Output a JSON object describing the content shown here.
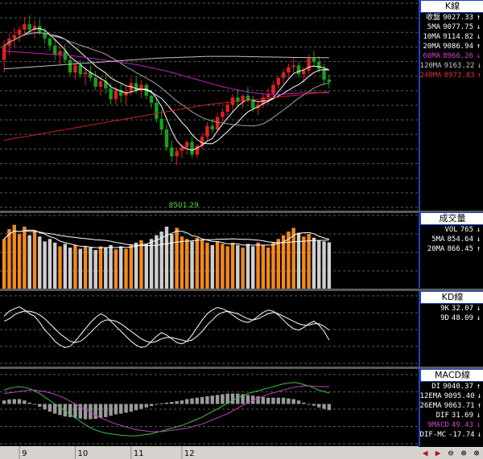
{
  "colors": {
    "up": "#e02020",
    "down": "#18a018",
    "vol_up": "#f28a1e",
    "vol_down": "#cfcfcf",
    "ma5": "#ffffff",
    "ma10": "#ffffff",
    "ma20": "#a0a0a0",
    "ma60": "#c020c0",
    "ma120": "#c0c0c0",
    "ma240": "#d02020",
    "panel_border": "#1a44c8"
  },
  "x_axis": {
    "ticks": [
      "9",
      "10",
      "11",
      "12"
    ]
  },
  "k_panel": {
    "title": "K線",
    "rows": [
      {
        "label": "收盤",
        "value": "9027.33",
        "arrow": "↑",
        "color": "#ffffff"
      },
      {
        "label": "5MA",
        "value": "9077.75",
        "arrow": "↓",
        "color": "#ffffff"
      },
      {
        "label": "10MA",
        "value": "9114.82",
        "arrow": "↓",
        "color": "#ffffff"
      },
      {
        "label": "20MA",
        "value": "9086.94",
        "arrow": "↑",
        "color": "#ffffff"
      },
      {
        "label": "60MA",
        "value": "8966.26",
        "arrow": "↓",
        "color": "#d040d0"
      },
      {
        "label": "120MA",
        "value": "9163.22",
        "arrow": "↓",
        "color": "#c8c8c8"
      },
      {
        "label": "240MA",
        "value": "8973.83",
        "arrow": "↑",
        "color": "#e03030"
      }
    ],
    "low_label": "8501.29"
  },
  "vol_panel": {
    "title": "成交量",
    "rows": [
      {
        "label": "VOL",
        "value": "765",
        "arrow": "↓",
        "color": "#ffffff"
      },
      {
        "label": "5MA",
        "value": "854.64",
        "arrow": "↓",
        "color": "#ffffff"
      },
      {
        "label": "20MA",
        "value": "866.45",
        "arrow": "↑",
        "color": "#ffffff"
      }
    ]
  },
  "kd_panel": {
    "title": "KD線",
    "rows": [
      {
        "label": "9K",
        "value": "32.07",
        "arrow": "↓",
        "color": "#ffffff"
      },
      {
        "label": "9D",
        "value": "48.09",
        "arrow": "↓",
        "color": "#ffffff"
      }
    ]
  },
  "macd_panel": {
    "title": "MACD線",
    "rows": [
      {
        "label": "DI",
        "value": "9040.37",
        "arrow": "↑",
        "color": "#ffffff"
      },
      {
        "label": "12EMA",
        "value": "9095.40",
        "arrow": "↓",
        "color": "#ffffff"
      },
      {
        "label": "26EMA",
        "value": "9063.71",
        "arrow": "↑",
        "color": "#ffffff"
      },
      {
        "label": "DIF",
        "value": "31.69",
        "arrow": "↓",
        "color": "#ffffff"
      },
      {
        "label": "9MACD",
        "value": "49.43",
        "arrow": "↓",
        "color": "#d040d0"
      },
      {
        "label": "DIF-MC",
        "value": "-17.74",
        "arrow": "↓",
        "color": "#ffffff"
      }
    ]
  },
  "chart_data": {
    "type": "candlestick",
    "ylim": [
      8450,
      9450
    ],
    "candles": [
      [
        9150,
        9260,
        9080,
        9230
      ],
      [
        9230,
        9300,
        9180,
        9270
      ],
      [
        9270,
        9330,
        9220,
        9290
      ],
      [
        9290,
        9340,
        9250,
        9320
      ],
      [
        9320,
        9390,
        9280,
        9350
      ],
      [
        9350,
        9400,
        9300,
        9320
      ],
      [
        9320,
        9370,
        9270,
        9340
      ],
      [
        9340,
        9380,
        9290,
        9300
      ],
      [
        9300,
        9330,
        9240,
        9270
      ],
      [
        9270,
        9300,
        9200,
        9230
      ],
      [
        9230,
        9270,
        9150,
        9180
      ],
      [
        9180,
        9230,
        9120,
        9200
      ],
      [
        9200,
        9240,
        9130,
        9150
      ],
      [
        9150,
        9170,
        9060,
        9080
      ],
      [
        9080,
        9140,
        9040,
        9120
      ],
      [
        9120,
        9150,
        9050,
        9070
      ],
      [
        9070,
        9110,
        9010,
        9080
      ],
      [
        9080,
        9120,
        9030,
        9050
      ],
      [
        9050,
        9090,
        8980,
        9000
      ],
      [
        9000,
        9060,
        8950,
        9030
      ],
      [
        9030,
        9070,
        8960,
        8990
      ],
      [
        8990,
        9020,
        8900,
        8930
      ],
      [
        8930,
        9000,
        8900,
        8980
      ],
      [
        8980,
        9020,
        8910,
        8950
      ],
      [
        8950,
        9000,
        8900,
        8970
      ],
      [
        8970,
        9050,
        8950,
        9020
      ],
      [
        9020,
        9060,
        8960,
        8980
      ],
      [
        8980,
        9040,
        8940,
        9010
      ],
      [
        9010,
        9020,
        8930,
        8950
      ],
      [
        8950,
        8980,
        8880,
        8910
      ],
      [
        8910,
        8940,
        8800,
        8820
      ],
      [
        8820,
        8870,
        8730,
        8760
      ],
      [
        8760,
        8790,
        8640,
        8660
      ],
      [
        8660,
        8700,
        8580,
        8610
      ],
      [
        8610,
        8660,
        8560,
        8640
      ],
      [
        8640,
        8680,
        8600,
        8660
      ],
      [
        8660,
        8700,
        8620,
        8690
      ],
      [
        8690,
        8720,
        8600,
        8620
      ],
      [
        8620,
        8680,
        8600,
        8670
      ],
      [
        8670,
        8740,
        8650,
        8720
      ],
      [
        8720,
        8800,
        8700,
        8780
      ],
      [
        8780,
        8820,
        8740,
        8760
      ],
      [
        8760,
        8850,
        8750,
        8830
      ],
      [
        8830,
        8880,
        8800,
        8860
      ],
      [
        8860,
        8920,
        8840,
        8900
      ],
      [
        8900,
        8960,
        8860,
        8940
      ],
      [
        8940,
        8980,
        8890,
        8920
      ],
      [
        8920,
        8960,
        8880,
        8950
      ],
      [
        8950,
        9000,
        8910,
        8930
      ],
      [
        8930,
        8950,
        8860,
        8880
      ],
      [
        8880,
        8920,
        8840,
        8900
      ],
      [
        8900,
        8960,
        8880,
        8940
      ],
      [
        8940,
        8990,
        8900,
        8960
      ],
      [
        8960,
        9030,
        8940,
        9010
      ],
      [
        9010,
        9060,
        8990,
        9050
      ],
      [
        9050,
        9100,
        9020,
        9080
      ],
      [
        9080,
        9130,
        9050,
        9110
      ],
      [
        9110,
        9160,
        9080,
        9120
      ],
      [
        9120,
        9140,
        9050,
        9070
      ],
      [
        9070,
        9110,
        9020,
        9090
      ],
      [
        9090,
        9180,
        9070,
        9160
      ],
      [
        9160,
        9200,
        9110,
        9140
      ],
      [
        9140,
        9170,
        9080,
        9100
      ],
      [
        9100,
        9130,
        9010,
        9040
      ],
      [
        9040,
        9070,
        8990,
        9027
      ]
    ],
    "ma_series": [
      {
        "name": "5MA",
        "key": "ma5",
        "window": 5
      },
      {
        "name": "10MA",
        "key": "ma10",
        "window": 10
      },
      {
        "name": "20MA",
        "key": "ma20",
        "window": 20
      },
      {
        "name": "60MA",
        "key": "ma60",
        "values": [
          9200,
          9198,
          9196,
          9194,
          9192,
          9190,
          9188,
          9186,
          9184,
          9182,
          9180,
          9178,
          9176,
          9174,
          9172,
          9168,
          9164,
          9160,
          9156,
          9152,
          9148,
          9144,
          9140,
          9136,
          9132,
          9128,
          9124,
          9118,
          9112,
          9106,
          9100,
          9094,
          9088,
          9080,
          9072,
          9064,
          9056,
          9048,
          9040,
          9032,
          9024,
          9016,
          9008,
          9000,
          8994,
          8988,
          8982,
          8976,
          8970,
          8966,
          8962,
          8960,
          8958,
          8956,
          8956,
          8958,
          8960,
          8962,
          8964,
          8966,
          8968,
          8968,
          8967,
          8966,
          8966
        ]
      },
      {
        "name": "120MA",
        "key": "ma120",
        "values": [
          9100,
          9102,
          9104,
          9106,
          9108,
          9110,
          9112,
          9114,
          9116,
          9118,
          9120,
          9122,
          9124,
          9126,
          9128,
          9130,
          9132,
          9134,
          9136,
          9138,
          9140,
          9142,
          9144,
          9146,
          9148,
          9150,
          9152,
          9154,
          9156,
          9158,
          9160,
          9161,
          9162,
          9163,
          9164,
          9165,
          9166,
          9167,
          9168,
          9169,
          9170,
          9170,
          9170,
          9170,
          9170,
          9170,
          9170,
          9169,
          9169,
          9168,
          9168,
          9167,
          9167,
          9166,
          9166,
          9165,
          9165,
          9164,
          9164,
          9164,
          9163,
          9163,
          9163,
          9163,
          9163
        ]
      },
      {
        "name": "240MA",
        "key": "ma240",
        "values": [
          8700,
          8705,
          8710,
          8715,
          8720,
          8725,
          8730,
          8735,
          8740,
          8745,
          8750,
          8755,
          8760,
          8765,
          8770,
          8775,
          8780,
          8785,
          8790,
          8795,
          8800,
          8805,
          8810,
          8815,
          8820,
          8825,
          8830,
          8835,
          8840,
          8845,
          8850,
          8855,
          8860,
          8865,
          8870,
          8875,
          8880,
          8885,
          8890,
          8895,
          8900,
          8903,
          8906,
          8909,
          8912,
          8915,
          8918,
          8921,
          8924,
          8927,
          8930,
          8933,
          8936,
          8939,
          8942,
          8945,
          8948,
          8951,
          8954,
          8957,
          8960,
          8963,
          8966,
          8970,
          8973
        ]
      }
    ],
    "volume": [
      820,
      980,
      1050,
      900,
      1020,
      880,
      950,
      860,
      780,
      820,
      760,
      700,
      740,
      680,
      720,
      660,
      700,
      680,
      640,
      700,
      680,
      720,
      650,
      700,
      660,
      720,
      760,
      800,
      740,
      820,
      880,
      940,
      1020,
      900,
      1000,
      860,
      820,
      780,
      840,
      800,
      760,
      720,
      780,
      740,
      700,
      760,
      720,
      680,
      740,
      700,
      760,
      720,
      680,
      760,
      820,
      880,
      940,
      1000,
      920,
      860,
      900,
      840,
      800,
      780,
      765
    ],
    "vol_ylim": [
      0,
      1150
    ],
    "kd": {
      "k": [
        70,
        78,
        82,
        85,
        80,
        74,
        70,
        60,
        48,
        40,
        30,
        24,
        20,
        22,
        30,
        40,
        50,
        60,
        68,
        74,
        70,
        62,
        54,
        46,
        38,
        30,
        24,
        20,
        22,
        30,
        38,
        44,
        40,
        34,
        28,
        26,
        30,
        40,
        52,
        64,
        74,
        80,
        84,
        82,
        78,
        72,
        66,
        62,
        60,
        64,
        70,
        76,
        80,
        78,
        72,
        64,
        56,
        50,
        48,
        52,
        58,
        62,
        56,
        46,
        32.07
      ],
      "d": [
        62,
        66,
        72,
        76,
        78,
        78,
        76,
        72,
        66,
        58,
        50,
        42,
        36,
        30,
        28,
        30,
        36,
        44,
        52,
        60,
        64,
        64,
        62,
        58,
        52,
        46,
        40,
        34,
        30,
        28,
        30,
        34,
        36,
        36,
        34,
        32,
        30,
        32,
        38,
        46,
        56,
        64,
        72,
        76,
        78,
        76,
        74,
        70,
        66,
        64,
        66,
        70,
        74,
        76,
        74,
        70,
        66,
        62,
        58,
        56,
        56,
        58,
        58,
        54,
        48.09
      ],
      "ylim": [
        0,
        100
      ]
    },
    "macd": {
      "dif": [
        40,
        45,
        48,
        50,
        48,
        44,
        38,
        30,
        20,
        10,
        0,
        -10,
        -20,
        -30,
        -40,
        -50,
        -60,
        -68,
        -75,
        -80,
        -84,
        -86,
        -88,
        -90,
        -91,
        -92,
        -92,
        -90,
        -88,
        -86,
        -82,
        -78,
        -74,
        -70,
        -66,
        -62,
        -56,
        -50,
        -44,
        -38,
        -30,
        -22,
        -14,
        -6,
        2,
        10,
        18,
        24,
        30,
        34,
        38,
        42,
        46,
        50,
        54,
        58,
        60,
        62,
        60,
        56,
        52,
        46,
        40,
        36,
        31.69
      ],
      "macd9": [
        30,
        32,
        34,
        36,
        38,
        40,
        40,
        38,
        36,
        32,
        28,
        22,
        16,
        8,
        0,
        -8,
        -16,
        -24,
        -32,
        -40,
        -46,
        -52,
        -58,
        -62,
        -66,
        -70,
        -74,
        -76,
        -78,
        -80,
        -80,
        -80,
        -78,
        -76,
        -74,
        -72,
        -70,
        -66,
        -62,
        -58,
        -52,
        -46,
        -40,
        -34,
        -28,
        -20,
        -12,
        -4,
        4,
        10,
        16,
        22,
        28,
        32,
        36,
        40,
        44,
        48,
        50,
        52,
        52,
        51,
        50,
        50,
        49.43
      ],
      "ylim": [
        -110,
        80
      ]
    }
  }
}
